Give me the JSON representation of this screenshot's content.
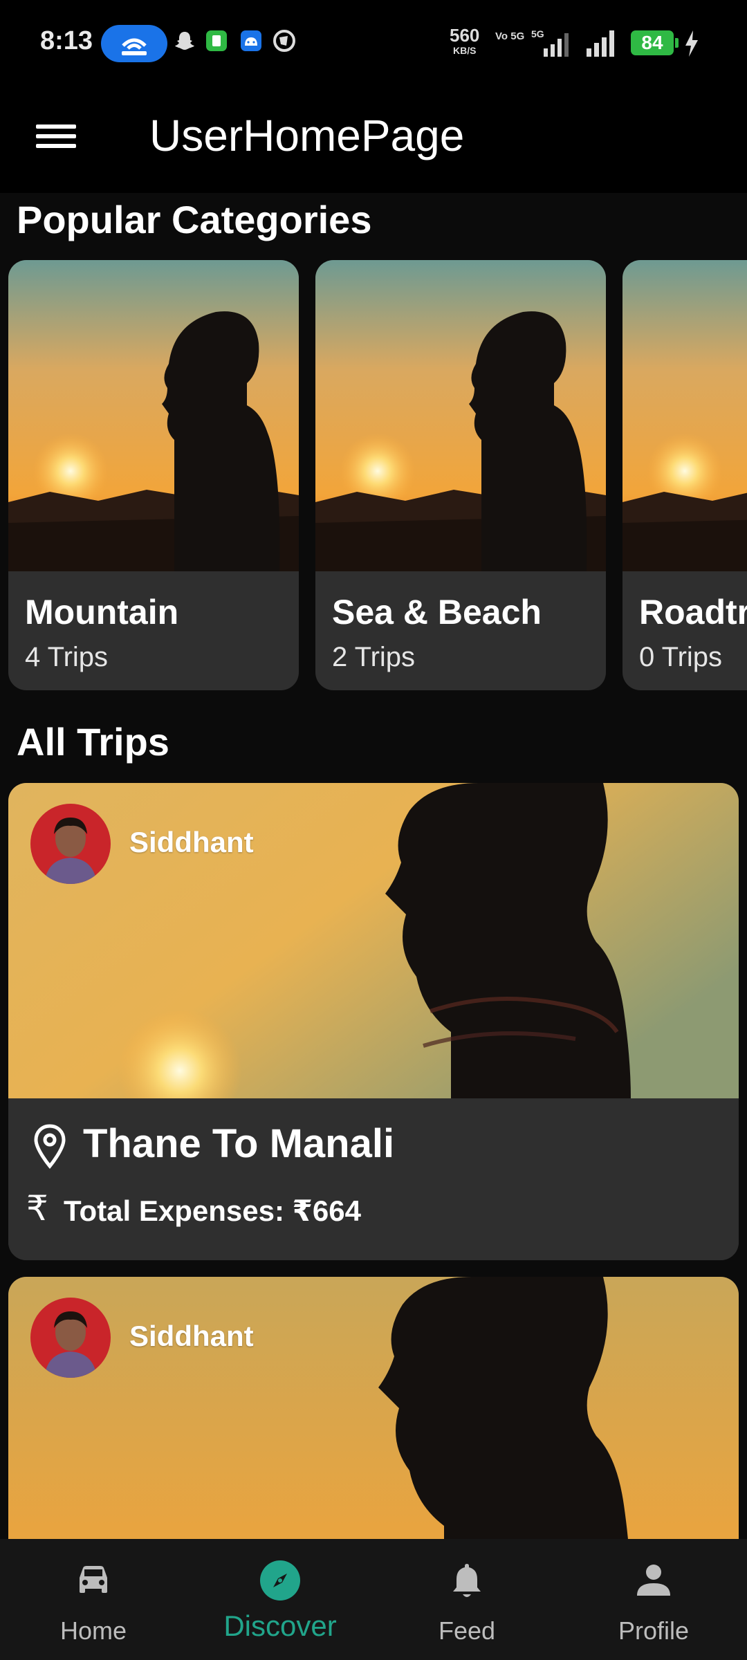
{
  "status_bar": {
    "time": "8:13",
    "net_speed": "560",
    "net_unit": "KB/S",
    "volte": "Vo 5G",
    "network": "5G",
    "battery": "84",
    "colors": {
      "hotspot_pill": "#1a73e8",
      "battery": "#2fb944"
    }
  },
  "app_bar": {
    "title": "UserHomePage",
    "menu_icon": "hamburger-menu-icon"
  },
  "popular_categories": {
    "title": "Popular Categories",
    "items": [
      {
        "name": "Mountain",
        "count": "4 Trips"
      },
      {
        "name": "Sea & Beach",
        "count": "2 Trips"
      },
      {
        "name": "Roadtrip",
        "count": "0 Trips"
      }
    ]
  },
  "all_trips": {
    "title": "All Trips",
    "items": [
      {
        "user": "Siddhant",
        "title": "Thane To Manali",
        "expenses": "Total Expenses: ₹664"
      },
      {
        "user": "Siddhant",
        "title": "",
        "expenses": ""
      }
    ]
  },
  "bottom_nav": {
    "items": [
      {
        "label": "Home",
        "icon": "car-icon"
      },
      {
        "label": "Discover",
        "icon": "compass-icon",
        "active": true
      },
      {
        "label": "Feed",
        "icon": "bell-icon"
      },
      {
        "label": "Profile",
        "icon": "person-icon"
      }
    ],
    "active_color": "#21a58b"
  }
}
